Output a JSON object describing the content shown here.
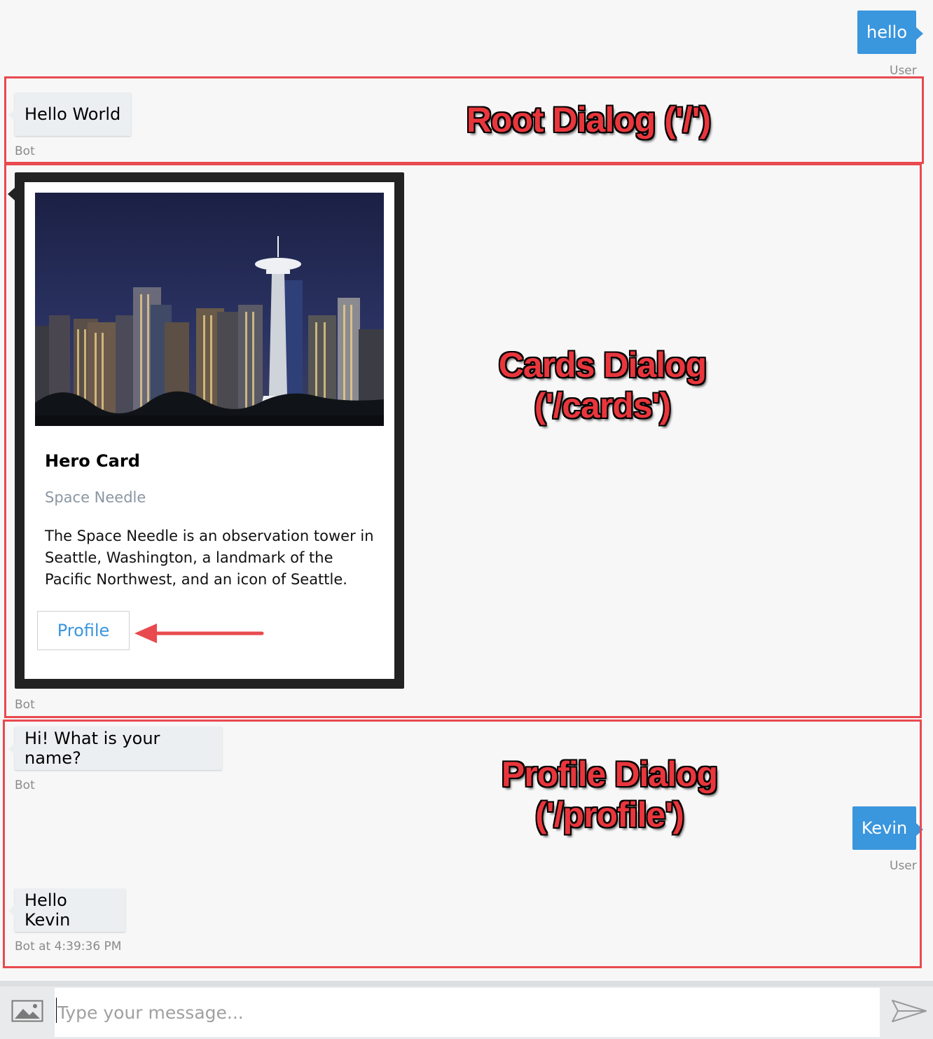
{
  "messages": {
    "user_hello": {
      "text": "hello",
      "meta": "User"
    },
    "bot_hello_world": {
      "text": "Hello World",
      "meta": "Bot"
    },
    "bot_card": {
      "meta": "Bot"
    },
    "bot_name_prompt": {
      "text": "Hi! What is your name?",
      "meta": "Bot"
    },
    "user_kevin": {
      "text": "Kevin",
      "meta": "User"
    },
    "bot_hello_kevin": {
      "text": "Hello Kevin",
      "meta": "Bot at 4:39:36 PM"
    }
  },
  "hero_card": {
    "title": "Hero Card",
    "subtitle": "Space Needle",
    "text": "The Space Needle is an observation tower in Seattle, Washington, a landmark of the Pacific Northwest, and an icon of Seattle.",
    "button_label": "Profile"
  },
  "annotations": {
    "root": {
      "line1": "Root Dialog ('/')"
    },
    "cards": {
      "line1": "Cards Dialog",
      "line2": "('/cards')"
    },
    "profile": {
      "line1": "Profile Dialog",
      "line2": "('/profile')"
    }
  },
  "input": {
    "placeholder": "Type your message..."
  },
  "colors": {
    "user_bubble": "#3a96dd",
    "annotation_red": "#e84a4f",
    "card_frame": "#222222"
  },
  "icons": {
    "upload": "image-upload-icon",
    "send": "send-icon"
  }
}
